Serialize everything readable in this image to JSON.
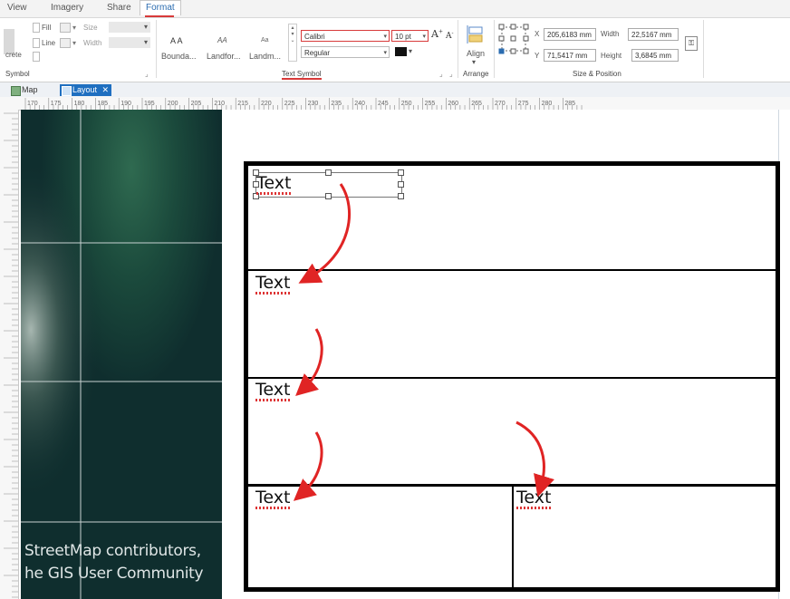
{
  "ribbon_tabs": [
    "View",
    "Imagery",
    "Share",
    "Format"
  ],
  "symbol_group": {
    "fill_label": "Fill",
    "line_label": "Line",
    "size_label": "Size",
    "width_label": "Width",
    "crete_label": "crete",
    "group_label": "Symbol"
  },
  "text_symbol_group": {
    "gallery_previews": [
      "A A",
      "AA",
      "Aa"
    ],
    "gallery": [
      "Bounda...",
      "Landfor...",
      "Landm..."
    ],
    "font_name": "Calibri",
    "font_size": "10 pt",
    "font_style": "Regular",
    "grow_font": "A",
    "shrink_font": "A",
    "group_label": "Text Symbol"
  },
  "arrange_group": {
    "align_label": "Align",
    "group_label": "Arrange"
  },
  "size_position_group": {
    "x_label": "X",
    "x_value": "205,6183 mm",
    "y_label": "Y",
    "y_value": "71,5417 mm",
    "width_label": "Width",
    "width_value": "22,5167 mm",
    "height_label": "Height",
    "height_value": "3,6845 mm",
    "group_label": "Size & Position"
  },
  "view_tabs": [
    {
      "label": "Map",
      "active": false
    },
    {
      "label": "Layout",
      "active": true
    }
  ],
  "ruler_labels": [
    "170",
    "175",
    "180",
    "185",
    "190",
    "195",
    "200",
    "205",
    "210",
    "215",
    "220",
    "225",
    "230",
    "235",
    "240",
    "245",
    "250",
    "255",
    "260",
    "265",
    "270",
    "275",
    "280",
    "285"
  ],
  "map_credits": [
    "StreetMap contributors,",
    "he GIS User Community"
  ],
  "layout_texts": [
    "Text",
    "Text",
    "Text",
    "Text",
    "Text"
  ],
  "colors": {
    "accent": "#2b6cb0",
    "highlight_red": "#d83a3a",
    "arrow_red": "#e02424",
    "map_dark": "#0f2e2e",
    "frame_black": "#000000"
  }
}
